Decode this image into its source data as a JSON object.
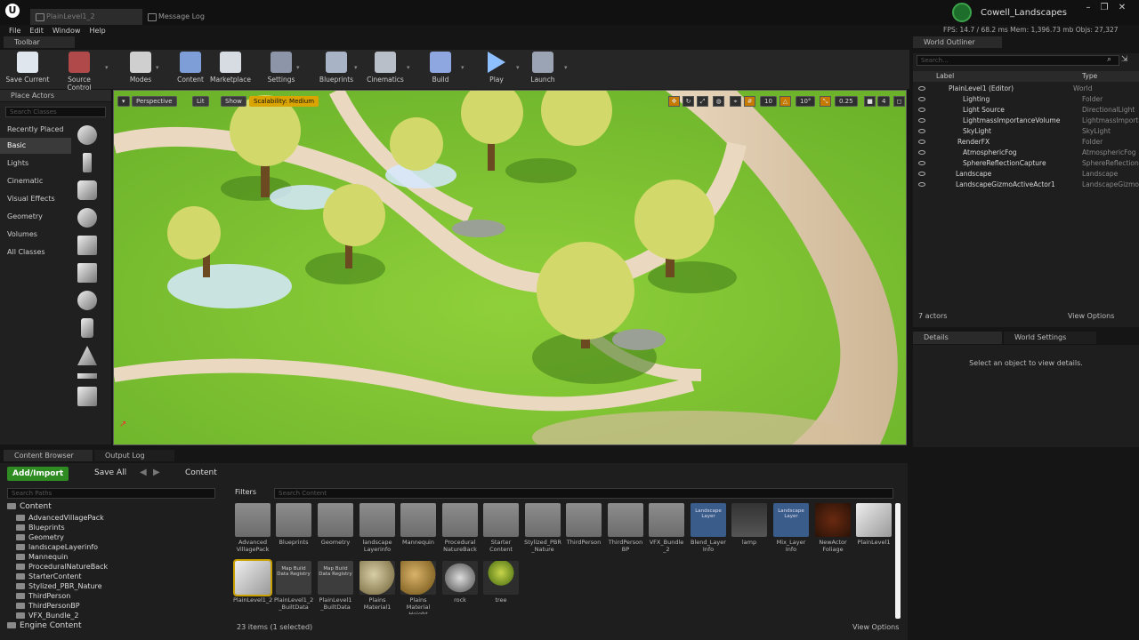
{
  "titlebar": {
    "tabs": [
      "PlainLevel1_2",
      "Message Log"
    ],
    "project_name": "Cowell_Landscapes",
    "window_buttons": [
      "–",
      "❐",
      "✕"
    ]
  },
  "menu": [
    "File",
    "Edit",
    "Window",
    "Help"
  ],
  "perf": "FPS: 14.7  /  68.2 ms   Mem: 1,396.73 mb   Objs: 27,327",
  "toolbar": {
    "tab_label": "Toolbar",
    "buttons": [
      "Save Current",
      "Source Control",
      "Modes",
      "Content",
      "Marketplace",
      "Settings",
      "Blueprints",
      "Cinematics",
      "Build",
      "Play",
      "Launch"
    ]
  },
  "place_actors": {
    "tab_label": "Place Actors",
    "search_placeholder": "Search Classes",
    "categories": [
      "Recently Placed",
      "Basic",
      "Lights",
      "Cinematic",
      "Visual Effects",
      "Geometry",
      "Volumes",
      "All Classes"
    ],
    "selected": "Basic"
  },
  "viewport": {
    "perspective": "Perspective",
    "lit": "Lit",
    "show": "Show",
    "scalability": "Scalability: Medium",
    "grid_size": "10",
    "rotation_snap": "10°",
    "scale_snap": "0.25",
    "camera_speed": "4"
  },
  "outliner": {
    "tab_label": "World Outliner",
    "search_placeholder": "Search...",
    "col_label": "Label",
    "col_type": "Type",
    "rows": [
      {
        "label": "PlainLevel1 (Editor)",
        "type": "World"
      },
      {
        "label": "Lighting",
        "type": "Folder"
      },
      {
        "label": "Light Source",
        "type": "DirectionalLight"
      },
      {
        "label": "LightmassImportanceVolume",
        "type": "LightmassImporta"
      },
      {
        "label": "SkyLight",
        "type": "SkyLight"
      },
      {
        "label": "RenderFX",
        "type": "Folder"
      },
      {
        "label": "AtmosphericFog",
        "type": "AtmosphericFog"
      },
      {
        "label": "SphereReflectionCapture",
        "type": "SphereReflectionC"
      },
      {
        "label": "Landscape",
        "type": "Landscape"
      },
      {
        "label": "LandscapeGizmoActiveActor1",
        "type": "LandscapeGizmo"
      }
    ],
    "actor_count": "7 actors",
    "view_options": "View Options"
  },
  "details": {
    "tab_details": "Details",
    "tab_world_settings": "World Settings",
    "empty_message": "Select an object to view details."
  },
  "content_browser": {
    "tab_label": "Content Browser",
    "output_log_label": "Output Log",
    "add_import": "Add/Import",
    "save_all": "Save All",
    "path": "Content",
    "search_paths_placeholder": "Search Paths",
    "filters": "Filters",
    "search_content_placeholder": "Search Content",
    "tree_root": "Content",
    "tree": [
      "AdvancedVillagePack",
      "Blueprints",
      "Geometry",
      "landscapeLayerinfo",
      "Mannequin",
      "ProceduralNatureBack",
      "StarterContent",
      "Stylized_PBR_Nature",
      "ThirdPerson",
      "ThirdPersonBP",
      "VFX_Bundle_2"
    ],
    "engine_content": "Engine Content",
    "assets_row1": [
      "Advanced VillagePack",
      "Blueprints",
      "Geometry",
      "landscape Layerinfo",
      "Mannequin",
      "Procedural NatureBack",
      "Starter Content",
      "Stylized_PBR _Nature",
      "ThirdPerson",
      "ThirdPerson BP",
      "VFX_Bundle _2",
      "Blend_Layer Info",
      "lamp",
      "Mix_Layer Info",
      "NewActor Foliage",
      "PlainLevel1"
    ],
    "assets_row2": [
      "PlainLevel1_2",
      "PlainLevel1_2 _BuiltData",
      "PlainLevel1 _BuiltData",
      "Plains Material1",
      "Plains Material Height",
      "rock",
      "tree"
    ],
    "thumb_texts": {
      "map_build": "Map Build Data Registry",
      "landscape_layer": "Landscape Layer"
    },
    "item_count": "23 items (1 selected)",
    "view_options": "View Options"
  }
}
